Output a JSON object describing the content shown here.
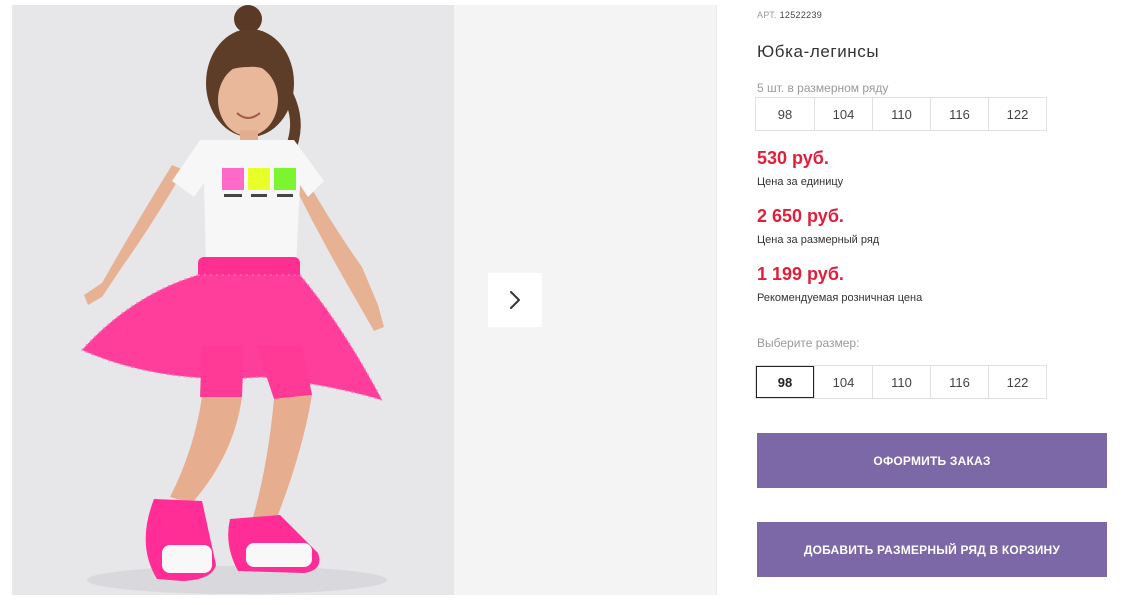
{
  "product": {
    "article_label": "АРТ.",
    "article_value": "12522239",
    "title": "Юбка-легинсы",
    "pack_note": "5 шт. в размерном ряду",
    "range_sizes": [
      "98",
      "104",
      "110",
      "116",
      "122"
    ],
    "prices": [
      {
        "value": "530 руб.",
        "label": "Цена за единицу"
      },
      {
        "value": "2 650 руб.",
        "label": "Цена за размерный ряд"
      },
      {
        "value": "1 199 руб.",
        "label": "Рекомендуемая розничная цена"
      }
    ],
    "choose_size_label": "Выберите размер:",
    "size_options": [
      "98",
      "104",
      "110",
      "116",
      "122"
    ],
    "selected_size": "98"
  },
  "actions": {
    "order_label": "ОФОРМИТЬ ЗАКАЗ",
    "add_range_label": "ДОБАВИТЬ РАЗМЕРНЫЙ РЯД В КОРЗИНУ"
  },
  "gallery": {
    "next_icon": "chevron-right-icon",
    "photo_subject": "product-photo"
  },
  "colors": {
    "price": "#e0203a",
    "button": "#7c68a6",
    "skirt": "#ff3d9a"
  }
}
